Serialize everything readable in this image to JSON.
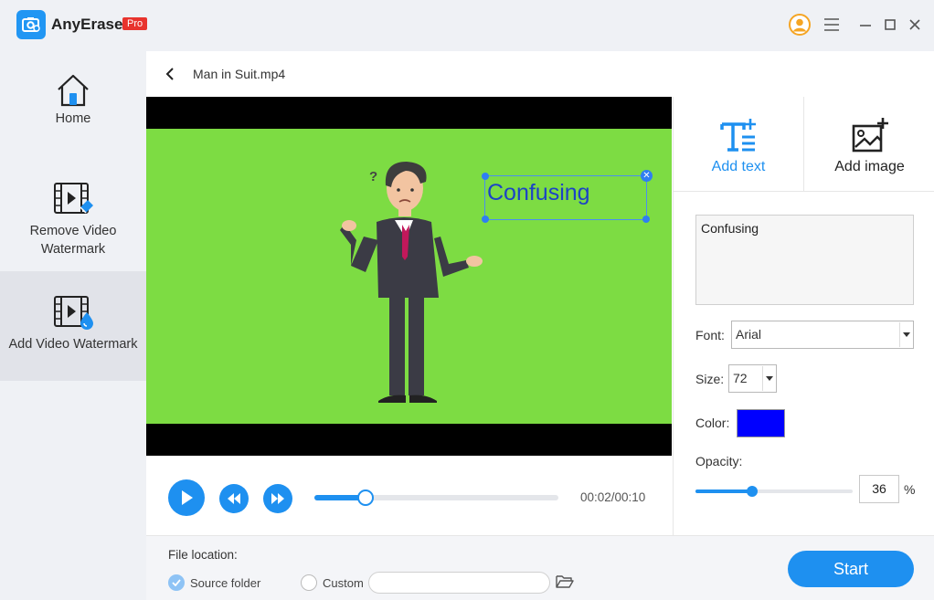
{
  "app": {
    "name": "AnyErase",
    "badge": "Pro"
  },
  "sidebar": {
    "items": [
      {
        "label": "Home"
      },
      {
        "label": "Remove Video Watermark"
      },
      {
        "label": "Add Video Watermark",
        "active": true
      }
    ]
  },
  "header": {
    "file_name": "Man in Suit.mp4"
  },
  "video": {
    "watermark_text": "Confusing",
    "question_mark": "?"
  },
  "player": {
    "time": "00:02/00:10",
    "progress": 0.21
  },
  "panel": {
    "tabs": [
      {
        "label": "Add text",
        "active": true
      },
      {
        "label": "Add image"
      }
    ],
    "text_value": "Confusing",
    "font_label": "Font:",
    "font_value": "Arial",
    "size_label": "Size:",
    "size_value": "72",
    "color_label": "Color:",
    "color_value": "#0000ff",
    "opacity_label": "Opacity:",
    "opacity_value": "36",
    "opacity_unit": "%"
  },
  "bottom": {
    "file_location_label": "File location:",
    "source_folder_label": "Source folder",
    "custom_label": "Custom",
    "start_label": "Start"
  },
  "colors": {
    "accent": "#1e90f0",
    "brand_badge": "#e8332d",
    "video_bg": "#7ddc43",
    "watermark_text": "#1c43c6"
  }
}
